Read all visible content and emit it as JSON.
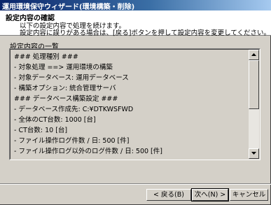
{
  "window": {
    "title": "運用環境保守ウィザード(環境構築・削除)"
  },
  "header": {
    "title": "設定内容の確認",
    "line1": "以下の設定内容で処理を続けます。",
    "line2": "設定内容に誤りがある場合は、[戻る]ボタンを押して設定内容を変更してください。"
  },
  "settings": {
    "label": "設定内容の一覧",
    "lines": [
      "### 処理種別 ###",
      "- 対象処理 ==> 運用環境の構築",
      "- 対象データベース: 運用データベース",
      "- 構築オプション: 統合管理サーバ",
      "### データベース構築設定 ###",
      "- データベース作成先: C:¥DTKWSFWD",
      "- 全体のCT台数: 1000 [台]",
      "- CT台数: 10 [台]",
      "- ファイル操作ログ件数 / 日: 500 [件]",
      "- ファイル操作ログ以外のログ件数 / 日: 500 [件]"
    ]
  },
  "buttons": {
    "back": "< 戻る(B)",
    "next": "次へ(N) >",
    "cancel": "キャンセル"
  }
}
